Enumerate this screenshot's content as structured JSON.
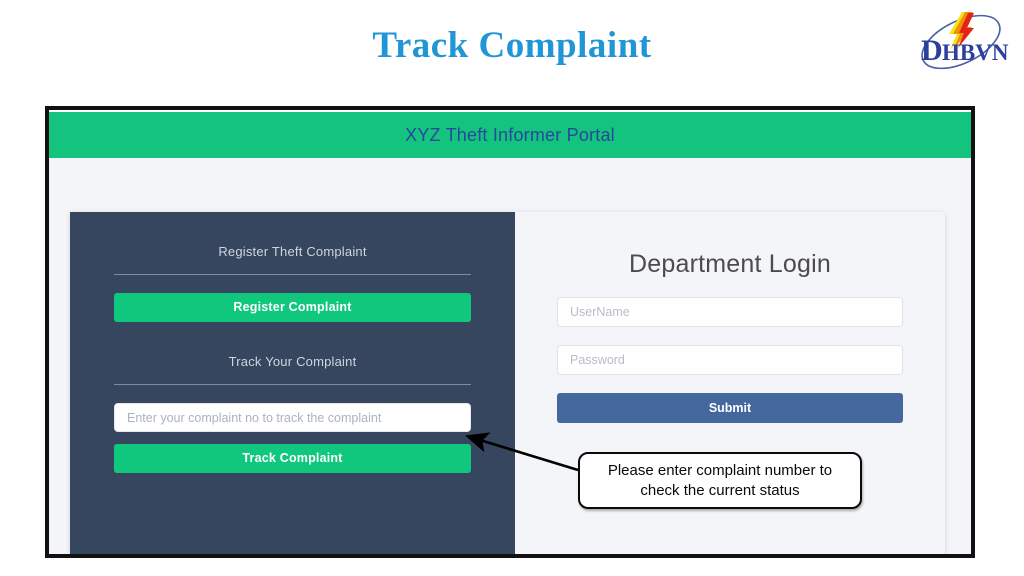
{
  "slide": {
    "title": "Track Complaint"
  },
  "logo": {
    "name": "dhbvn-logo",
    "text_lead": "D",
    "text_rest": "HBVN",
    "bolt_colors": [
      "#f4e21a",
      "#f39200",
      "#e2231a"
    ],
    "swoosh_color": "#4a5fa5",
    "text_color": "#2b3f9c"
  },
  "portal": {
    "header_title": "XYZ Theft Informer Portal",
    "header_bg": "#14c37d",
    "header_text_color": "#27489e"
  },
  "left_panel": {
    "bg": "#35465e",
    "register_heading": "Register Theft Complaint",
    "register_button": "Register Complaint",
    "track_heading": "Track Your Complaint",
    "track_input_placeholder": "Enter your complaint no to track the complaint",
    "track_input_value": "",
    "track_button": "Track Complaint",
    "button_color": "#0fc87e"
  },
  "right_panel": {
    "bg": "#f4f5f8",
    "login_heading": "Department Login",
    "username_placeholder": "UserName",
    "username_value": "",
    "password_placeholder": "Password",
    "password_value": "",
    "submit_button": "Submit",
    "submit_color": "#44689e"
  },
  "annotation": {
    "callout_text": "Please enter complaint number to check the current status",
    "arrow_color": "#000000"
  }
}
